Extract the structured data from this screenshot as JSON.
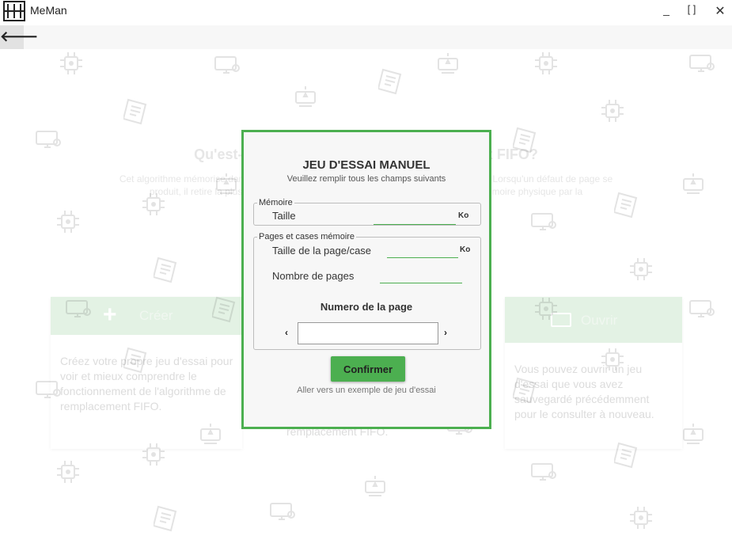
{
  "window": {
    "app_title": "MeMan",
    "min_label": "_",
    "max_label": "[ ]",
    "close_label": "✕"
  },
  "toolbar": {
    "back_label": "🡐"
  },
  "background": {
    "heading": "Qu'est-ce que l'algorithme de remplacement FIFO?",
    "paragraph_line1": "Cet algorithme mémorise dans une file FIFO les pages présentes en mémoire physique. Lorsqu'un défaut de page se",
    "paragraph_line2": "produit, il retire la plus ancienne, c'est à dire celle qui a été remplacée dans la mémoire physique par la",
    "cards": [
      {
        "title": "Créer",
        "text": "Créez votre propre jeu d'essai pour voir et mieux comprendre le fonctionnement de l'algorithme de remplacement FIFO."
      },
      {
        "title": "",
        "text": "remplacement FIFO."
      },
      {
        "title": "Ouvrir",
        "text": "Vous pouvez ouvrir un jeu d'essai que vous avez sauvegardé précédemment pour le consulter à nouveau."
      }
    ]
  },
  "dialog": {
    "title": "JEU D'ESSAI MANUEL",
    "subtitle": "Veuillez remplir tous les champs suivants",
    "memory_group": {
      "legend": "Mémoire",
      "size_label": "Taille",
      "size_value": "",
      "size_unit": "Ko"
    },
    "pages_group": {
      "legend": "Pages et cases mémoire",
      "page_size_label": "Taille de la page/case",
      "page_size_value": "",
      "page_size_unit": "Ko",
      "page_count_label": "Nombre de pages",
      "page_count_value": "",
      "page_number_label": "Numero de la page",
      "page_number_value": "",
      "prev_arrow": "‹",
      "next_arrow": "›"
    },
    "confirm_label": "Confirmer",
    "example_link": "Aller vers un exemple de jeu d'essai"
  },
  "colors": {
    "accent": "#4caf50",
    "card_header": "#e3f2e4",
    "dialog_bg": "#f7f7f7"
  }
}
